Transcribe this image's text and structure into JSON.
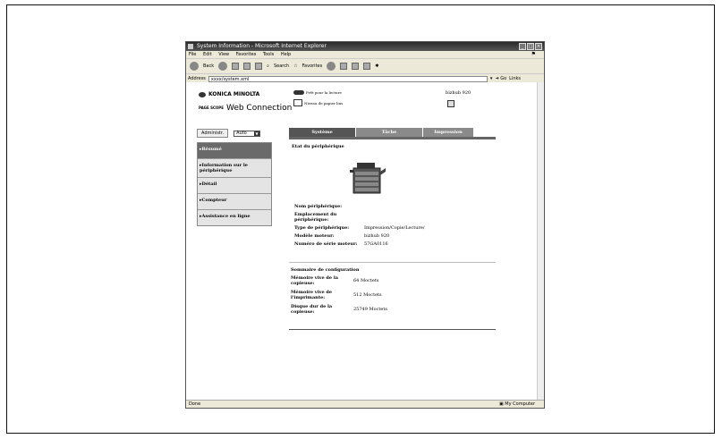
{
  "window": {
    "title": "System Information - Microsoft Internet Explorer",
    "menu": [
      "File",
      "Edit",
      "View",
      "Favorites",
      "Tools",
      "Help"
    ],
    "toolbar": {
      "back": "Back",
      "search": "Search",
      "favorites": "Favorites"
    },
    "address_label": "Address",
    "address_value": "xxxx/system.xml",
    "go_label": "Go",
    "links_label": "Links",
    "status_text": "Done",
    "zone_text": "My Computer"
  },
  "header": {
    "brand": "KONICA MINOLTA",
    "page_scope_small": "PAGE SCOPE",
    "product": "Web Connection",
    "notice_drum": "Prêt pour la lecture",
    "notice_paper": "Niveau de papier bas",
    "model": "bizhub 920"
  },
  "controls": {
    "admin_label": "Administr.",
    "select_value": "Auto"
  },
  "tabs": [
    {
      "label": "Système",
      "active": true
    },
    {
      "label": "Tâche",
      "active": false
    },
    {
      "label": "Impression",
      "active": false
    }
  ],
  "sidebar": {
    "items": [
      {
        "label": "Résumé",
        "active": true
      },
      {
        "label": "Information sur le périphérique",
        "active": false
      },
      {
        "label": "Détail",
        "active": false
      },
      {
        "label": "Compteur",
        "active": false
      },
      {
        "label": "Assistance en ligne",
        "active": false
      }
    ]
  },
  "main": {
    "section_title": "Etat du périphérique",
    "device_info": [
      {
        "label": "Nom périphérique:",
        "value": ""
      },
      {
        "label": "Emplacement du périphérique:",
        "value": ""
      },
      {
        "label": "Type de périphérique:",
        "value": "Impression/Copie/Lecture/"
      },
      {
        "label": "Modèle moteur:",
        "value": "bizhub 920"
      },
      {
        "label": "Numéro de série moteur:",
        "value": "57GA0116"
      }
    ],
    "config_title": "Sommaire de configuration",
    "config": [
      {
        "label": "Mémoire vive de la copieuse:",
        "value": "64 Moctets"
      },
      {
        "label": "Mémoire vive de l'imprimante:",
        "value": "512 Moctets"
      },
      {
        "label": "Disque dur de la copieuse:",
        "value": "25749 Moctets"
      }
    ]
  }
}
